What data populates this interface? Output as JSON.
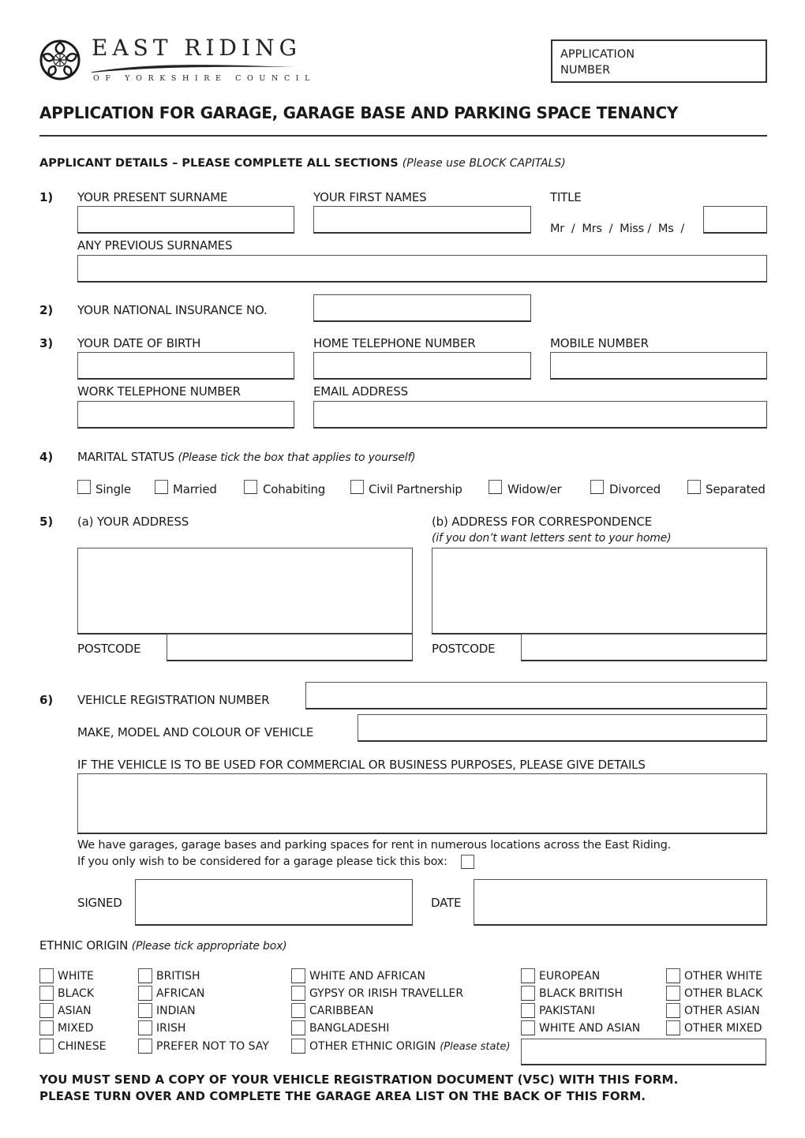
{
  "header": {
    "logo_icon": "yorkshire-rose-icon",
    "org_name": "EAST RIDING",
    "org_subtitle": "OF YORKSHIRE COUNCIL",
    "application_number_label_line1": "APPLICATION",
    "application_number_label_line2": "NUMBER"
  },
  "form_title": "APPLICATION FOR GARAGE, GARAGE BASE AND PARKING SPACE TENANCY",
  "section_heading": {
    "bold": "APPLICANT DETAILS – PLEASE COMPLETE ALL SECTIONS",
    "note": "(Please use BLOCK CAPITALS)"
  },
  "q1": {
    "number": "1)",
    "surname_label": "YOUR PRESENT SURNAME",
    "surname_value": "",
    "first_names_label": "YOUR FIRST NAMES",
    "first_names_value": "",
    "title_label": "TITLE",
    "title_options": "Mr  /  Mrs  /  Miss /  Ms  /",
    "title_other_value": "",
    "previous_surnames_label": "ANY PREVIOUS SURNAMES",
    "previous_surnames_value": ""
  },
  "q2": {
    "number": "2)",
    "ni_label": "YOUR NATIONAL INSURANCE NO.",
    "ni_value": ""
  },
  "q3": {
    "number": "3)",
    "dob_label": "YOUR DATE OF BIRTH",
    "home_tel_label": "HOME TELEPHONE NUMBER",
    "mobile_label": "MOBILE NUMBER",
    "work_tel_label": "WORK TELEPHONE NUMBER",
    "email_label": "EMAIL ADDRESS"
  },
  "q4": {
    "number": "4)",
    "label": "MARITAL STATUS",
    "note": "(Please tick the box that applies to yourself)",
    "options": [
      "Single",
      "Married",
      "Cohabiting",
      "Civil Partnership",
      "Widow/er",
      "Divorced",
      "Separated"
    ],
    "checked": []
  },
  "q5": {
    "number": "5)",
    "address_label": "(a) YOUR ADDRESS",
    "correspondence_label": "(b) ADDRESS FOR CORRESPONDENCE",
    "correspondence_note": "(if you don’t want letters sent to your home)",
    "postcode_label": "POSTCODE"
  },
  "q6": {
    "number": "6)",
    "reg_label": "VEHICLE REGISTRATION NUMBER",
    "make_label": "MAKE, MODEL AND COLOUR OF VEHICLE",
    "commercial_label": "IF THE VEHICLE IS TO BE USED FOR COMMERCIAL OR BUSINESS PURPOSES, PLEASE GIVE DETAILS",
    "info_line1": "We have garages, garage bases and parking spaces for rent in numerous locations across the East Riding.",
    "info_line2": "If you only wish to be considered for a garage please tick this box:",
    "garage_only_checked": false
  },
  "signature": {
    "signed_label": "SIGNED",
    "date_label": "DATE"
  },
  "ethnic": {
    "label": "ETHNIC ORIGIN",
    "note": "(Please tick appropriate box)",
    "columns": [
      [
        "WHITE",
        "BLACK",
        "ASIAN",
        "MIXED",
        "CHINESE"
      ],
      [
        "BRITISH",
        "AFRICAN",
        "INDIAN",
        "IRISH",
        "PREFER NOT TO SAY"
      ],
      [
        "WHITE AND AFRICAN",
        "GYPSY OR IRISH TRAVELLER",
        "CARIBBEAN",
        "BANGLADESHI",
        "OTHER ETHNIC ORIGIN"
      ],
      [
        "EUROPEAN",
        "BLACK BRITISH",
        "PAKISTANI",
        "WHITE AND ASIAN"
      ],
      [
        "OTHER WHITE",
        "OTHER BLACK",
        "OTHER ASIAN",
        "OTHER MIXED"
      ]
    ],
    "other_note": "(Please state)",
    "other_value": ""
  },
  "footer": {
    "line1": "YOU MUST SEND A COPY OF YOUR VEHICLE REGISTRATION DOCUMENT (V5C) WITH THIS FORM.",
    "line2": "PLEASE TURN OVER AND COMPLETE THE GARAGE AREA LIST ON THE BACK OF THIS FORM."
  }
}
